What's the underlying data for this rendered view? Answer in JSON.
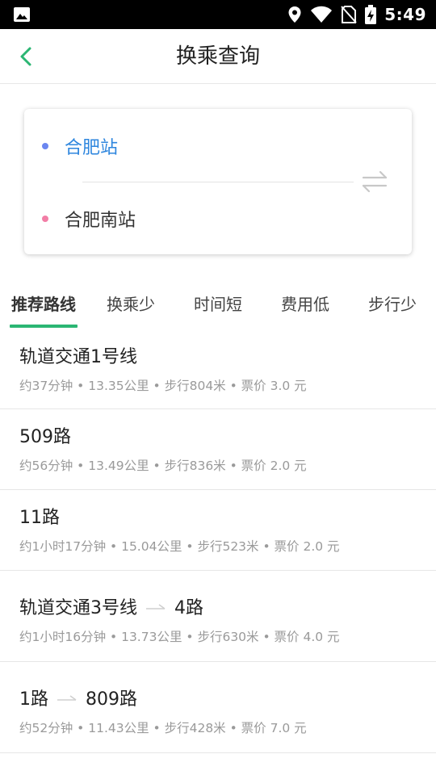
{
  "status_bar": {
    "time": "5:49",
    "icons": [
      "image-icon",
      "location-icon",
      "wifi-icon",
      "no-sim-icon",
      "battery-charging-icon"
    ]
  },
  "header": {
    "title": "换乘查询",
    "back_icon": "chevron-left-icon"
  },
  "query": {
    "origin": "合肥站",
    "destination": "合肥南站",
    "swap_icon": "swap-arrows-icon"
  },
  "tabs": [
    {
      "label": "推荐路线",
      "active": true
    },
    {
      "label": "换乘少",
      "active": false
    },
    {
      "label": "时间短",
      "active": false
    },
    {
      "label": "费用低",
      "active": false
    },
    {
      "label": "步行少",
      "active": false
    }
  ],
  "routes": [
    {
      "segments": [
        "轨道交通1号线"
      ],
      "meta": "约37分钟 • 13.35公里 • 步行804米 • 票价  3.0  元"
    },
    {
      "segments": [
        "509路"
      ],
      "meta": "约56分钟 • 13.49公里 • 步行836米 • 票价  2.0  元"
    },
    {
      "segments": [
        "11路"
      ],
      "meta": "约1小时17分钟 • 15.04公里 • 步行523米 • 票价  2.0  元"
    },
    {
      "segments": [
        "轨道交通3号线",
        "4路"
      ],
      "meta": "约1小时16分钟 • 13.73公里 • 步行630米 • 票价  4.0  元"
    },
    {
      "segments": [
        "1路",
        "809路"
      ],
      "meta": "约52分钟 • 11.43公里 • 步行428米 • 票价  7.0  元"
    }
  ],
  "colors": {
    "accent": "#2bb673",
    "origin_text": "#2e86de",
    "origin_dot": "#6b86f0",
    "destination_dot": "#f27ea6",
    "meta_text": "#9a9a9a"
  }
}
